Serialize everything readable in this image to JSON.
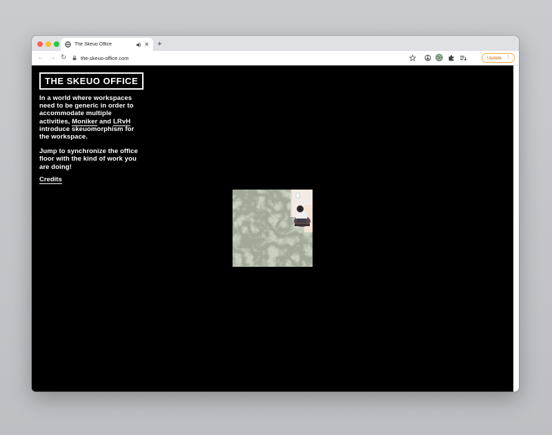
{
  "browser": {
    "tab_title": "The Skeuo Office",
    "new_tab_symbol": "+",
    "close_symbol": "✕",
    "audio_symbol": "◀)",
    "back_symbol": "←",
    "forward_symbol": "→",
    "reload_symbol": "↻",
    "url": "the-skeuo-office.com",
    "update_label": "Update",
    "update_menu_symbol": "⋮"
  },
  "page": {
    "logo": "THE SKEUO OFFICE",
    "intro": {
      "text1": "In a world where workspaces need to be generic in order to accommodate multiple activities, ",
      "link1": "Moniker",
      "and": " and ",
      "link2": "LRvH",
      "text2": " introduce skeuomorphism for the workspace."
    },
    "instruction": "Jump to synchronize the office floor with the kind of work you are doing!",
    "credits": "Credits"
  },
  "colors": {
    "page_bg": "#000000",
    "text": "#ffffff",
    "update_accent": "#f2a93b",
    "marble": "#c9d1c0"
  }
}
